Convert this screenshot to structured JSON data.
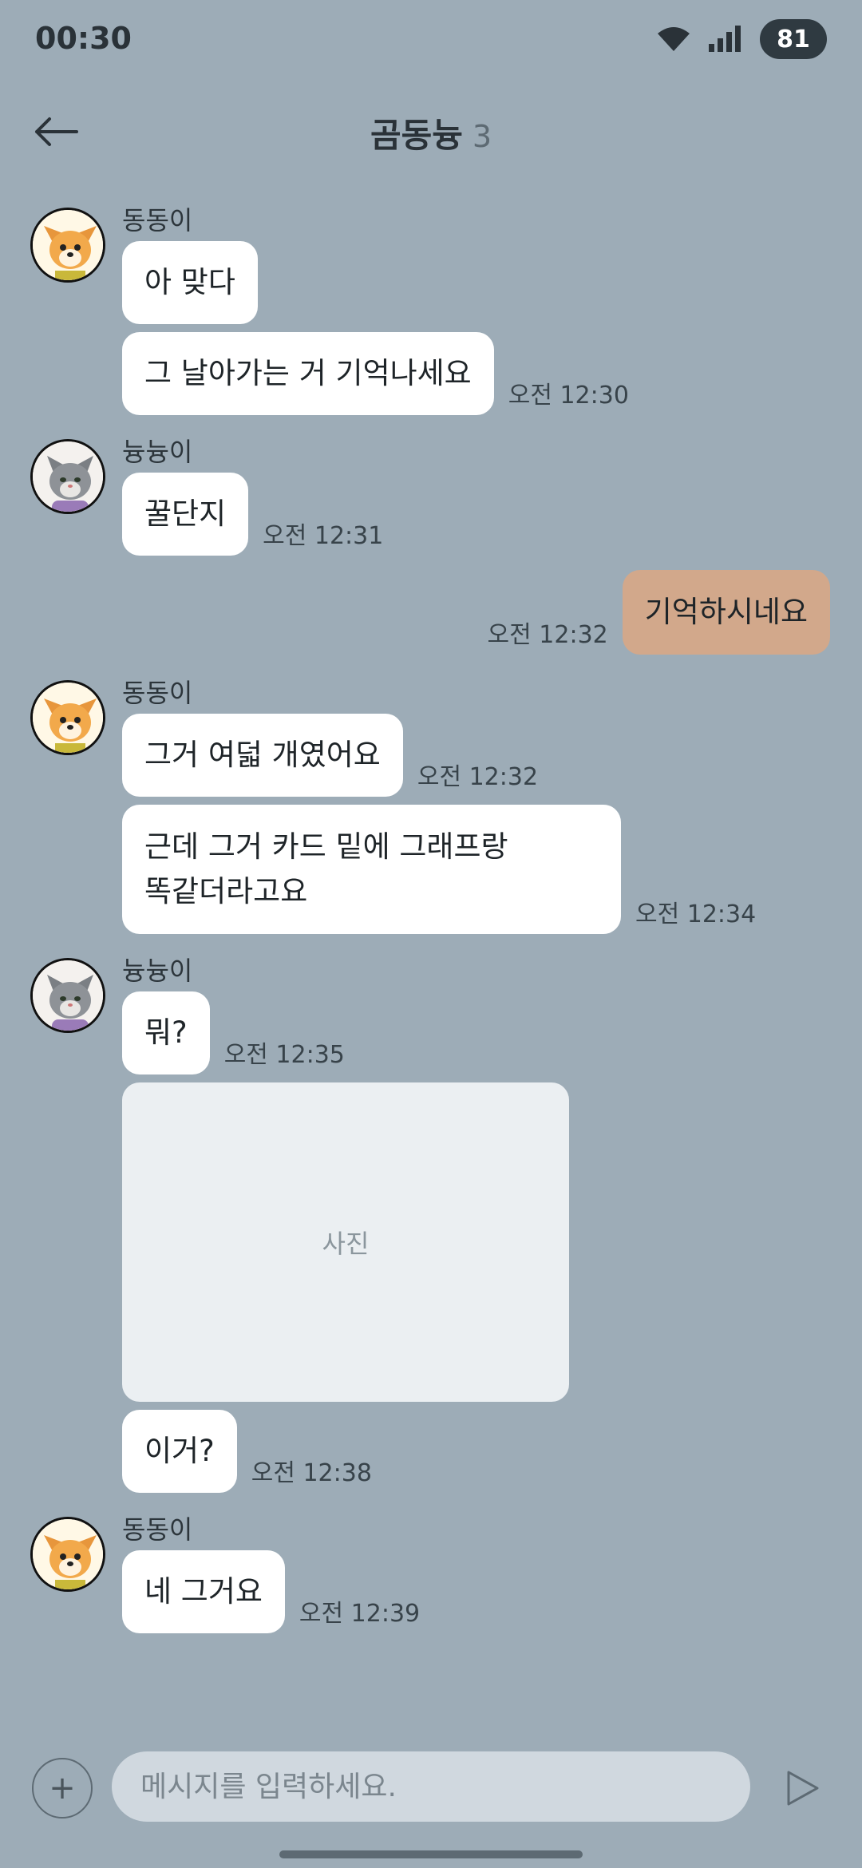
{
  "status": {
    "time": "00:30",
    "battery": "81"
  },
  "header": {
    "title": "곰동늉",
    "member_count": "3"
  },
  "messages": {
    "g1": {
      "sender": "동동이",
      "m1": "아 맞다",
      "m2": "그 날아가는 거 기억나세요",
      "m2_time": "오전 12:30"
    },
    "g2": {
      "sender": "늉늉이",
      "m1": "꿀단지",
      "m1_time": "오전 12:31"
    },
    "g3": {
      "m1": "기억하시네요",
      "m1_time": "오전 12:32"
    },
    "g4": {
      "sender": "동동이",
      "m1": "그거 여덟 개였어요",
      "m1_time": "오전 12:32",
      "m2_line1": "근데 그거 카드 밑에 그래프랑",
      "m2_line2": "똑같더라고요",
      "m2_time": "오전 12:34"
    },
    "g5": {
      "sender": "늉늉이",
      "m1": "뭐?",
      "m1_time": "오전 12:35",
      "photo_label": "사진",
      "m2": "이거?",
      "m2_time": "오전 12:38"
    },
    "g6": {
      "sender": "동동이",
      "m1": "네 그거요",
      "m1_time": "오전 12:39"
    }
  },
  "composer": {
    "placeholder": "메시지를 입력하세요.",
    "plus": "+"
  },
  "colors": {
    "background": "#9dacb7",
    "my_bubble": "#d2a88b",
    "other_bubble": "#ffffff",
    "input_bg": "#d0d8df"
  },
  "icons": {
    "back": "arrow-left-icon",
    "wifi": "wifi-icon",
    "signal": "signal-icon",
    "send": "send-icon",
    "dog_avatar": "dog-avatar-icon",
    "cat_avatar": "cat-avatar-icon"
  }
}
